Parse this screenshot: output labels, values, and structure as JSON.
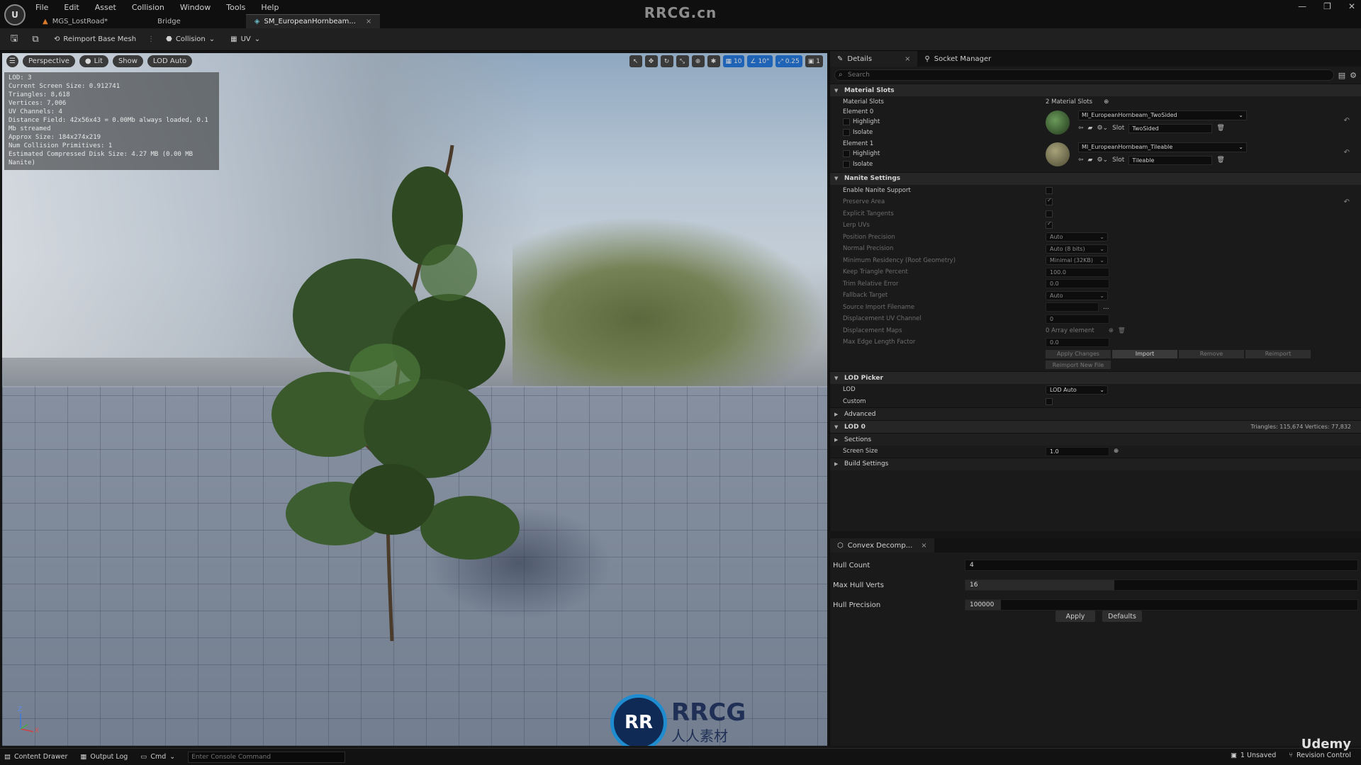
{
  "app": {
    "watermark_title": "RRCG.cn",
    "logo_text": "U",
    "window_controls": [
      "—",
      "❐",
      "✕"
    ]
  },
  "menu": [
    "File",
    "Edit",
    "Asset",
    "Collision",
    "Window",
    "Tools",
    "Help"
  ],
  "doc_tabs": [
    {
      "label": "MGS_LostRoad*",
      "icon": "level-icon"
    },
    {
      "label": "Bridge",
      "icon": ""
    },
    {
      "label": "SM_EuropeanHornbeam...",
      "icon": "static-mesh-icon",
      "active": true
    }
  ],
  "toolbar": {
    "reimport": "Reimport Base Mesh",
    "collision": "Collision",
    "uv": "UV"
  },
  "viewport": {
    "perspective": "Perspective",
    "lit": "Lit",
    "show": "Show",
    "lod": "LOD Auto",
    "grid_value": "10",
    "angle_value": "10°",
    "scale_value": "0.25",
    "camera_value": "1",
    "stats": [
      "LOD:  3",
      "Current Screen Size:  0.912741",
      "Triangles:  8,618",
      "Vertices:  7,006",
      "UV Channels:  4",
      "Distance Field:  42x56x43 = 0.00Mb always loaded, 0.1 Mb streamed",
      "Approx Size: 184x274x219",
      "Num Collision Primitives:  1",
      "Estimated Compressed Disk Size: 4.27 MB (0.00 MB Nanite)"
    ],
    "axis_z": "Z",
    "axis_x": "X",
    "wm_circle": "RR",
    "wm_text": "RRCG",
    "wm_sub": "人人素材"
  },
  "details": {
    "tab_details": "Details",
    "tab_socket": "Socket Manager",
    "search_placeholder": "Search",
    "material_slots": {
      "category": "Material Slots",
      "label": "Material Slots",
      "count": "2 Material Slots",
      "elements": [
        {
          "name": "Element 0",
          "material": "MI_EuropeanHornbeam_TwoSided",
          "slot": "TwoSided",
          "highlight": "Highlight",
          "isolate": "Isolate"
        },
        {
          "name": "Element 1",
          "material": "MI_EuropeanHornbeam_Tileable",
          "slot": "Tileable",
          "highlight": "Highlight",
          "isolate": "Isolate"
        }
      ],
      "slot_label": "Slot"
    },
    "nanite": {
      "category": "Nanite Settings",
      "enable": "Enable Nanite Support",
      "preserve_area": "Preserve Area",
      "explicit_tangents": "Explicit Tangents",
      "lerp_uvs": "Lerp UVs",
      "position_precision": {
        "label": "Position Precision",
        "value": "Auto"
      },
      "normal_precision": {
        "label": "Normal Precision",
        "value": "Auto (8 bits)"
      },
      "min_residency": {
        "label": "Minimum Residency (Root Geometry)",
        "value": "Minimal (32KB)"
      },
      "keep_triangle": {
        "label": "Keep Triangle Percent",
        "value": "100.0"
      },
      "trim_error": {
        "label": "Trim Relative Error",
        "value": "0.0"
      },
      "fallback": {
        "label": "Fallback Target",
        "value": "Auto"
      },
      "source_import": {
        "label": "Source Import Filename",
        "value": ""
      },
      "disp_uv": {
        "label": "Displacement UV Channel",
        "value": "0"
      },
      "disp_maps": {
        "label": "Displacement Maps",
        "value": "0 Array element"
      },
      "max_edge": {
        "label": "Max Edge Length Factor",
        "value": "0.0"
      },
      "buttons": [
        "Apply Changes",
        "Import",
        "Remove",
        "Reimport"
      ],
      "reimport_new": "Reimport New File"
    },
    "lod_picker": {
      "category": "LOD Picker",
      "lod_label": "LOD",
      "lod_value": "LOD Auto",
      "custom": "Custom"
    },
    "advanced": "Advanced",
    "lod0": {
      "category": "LOD 0",
      "info": "Triangles: 115,674   Vertices: 77,832",
      "sections": "Sections",
      "screen_size_label": "Screen Size",
      "screen_size_value": "1.0",
      "build_settings": "Build Settings"
    }
  },
  "convex": {
    "tab": "Convex Decomp...",
    "hull_count": {
      "label": "Hull Count",
      "value": "4",
      "fill": 0.0
    },
    "max_hull_verts": {
      "label": "Max Hull Verts",
      "value": "16",
      "fill": 0.38
    },
    "hull_precision": {
      "label": "Hull Precision",
      "value": "100000",
      "fill": 0.09
    },
    "apply": "Apply",
    "defaults": "Defaults"
  },
  "statusbar": {
    "content_drawer": "Content Drawer",
    "output_log": "Output Log",
    "cmd": "Cmd",
    "console_placeholder": "Enter Console Command",
    "unsaved": "1 Unsaved",
    "revision": "Revision Control"
  },
  "udemy": "Udemy",
  "colors": {
    "accent_blue": "#1e63b5",
    "level_orange": "#d87a2a"
  }
}
